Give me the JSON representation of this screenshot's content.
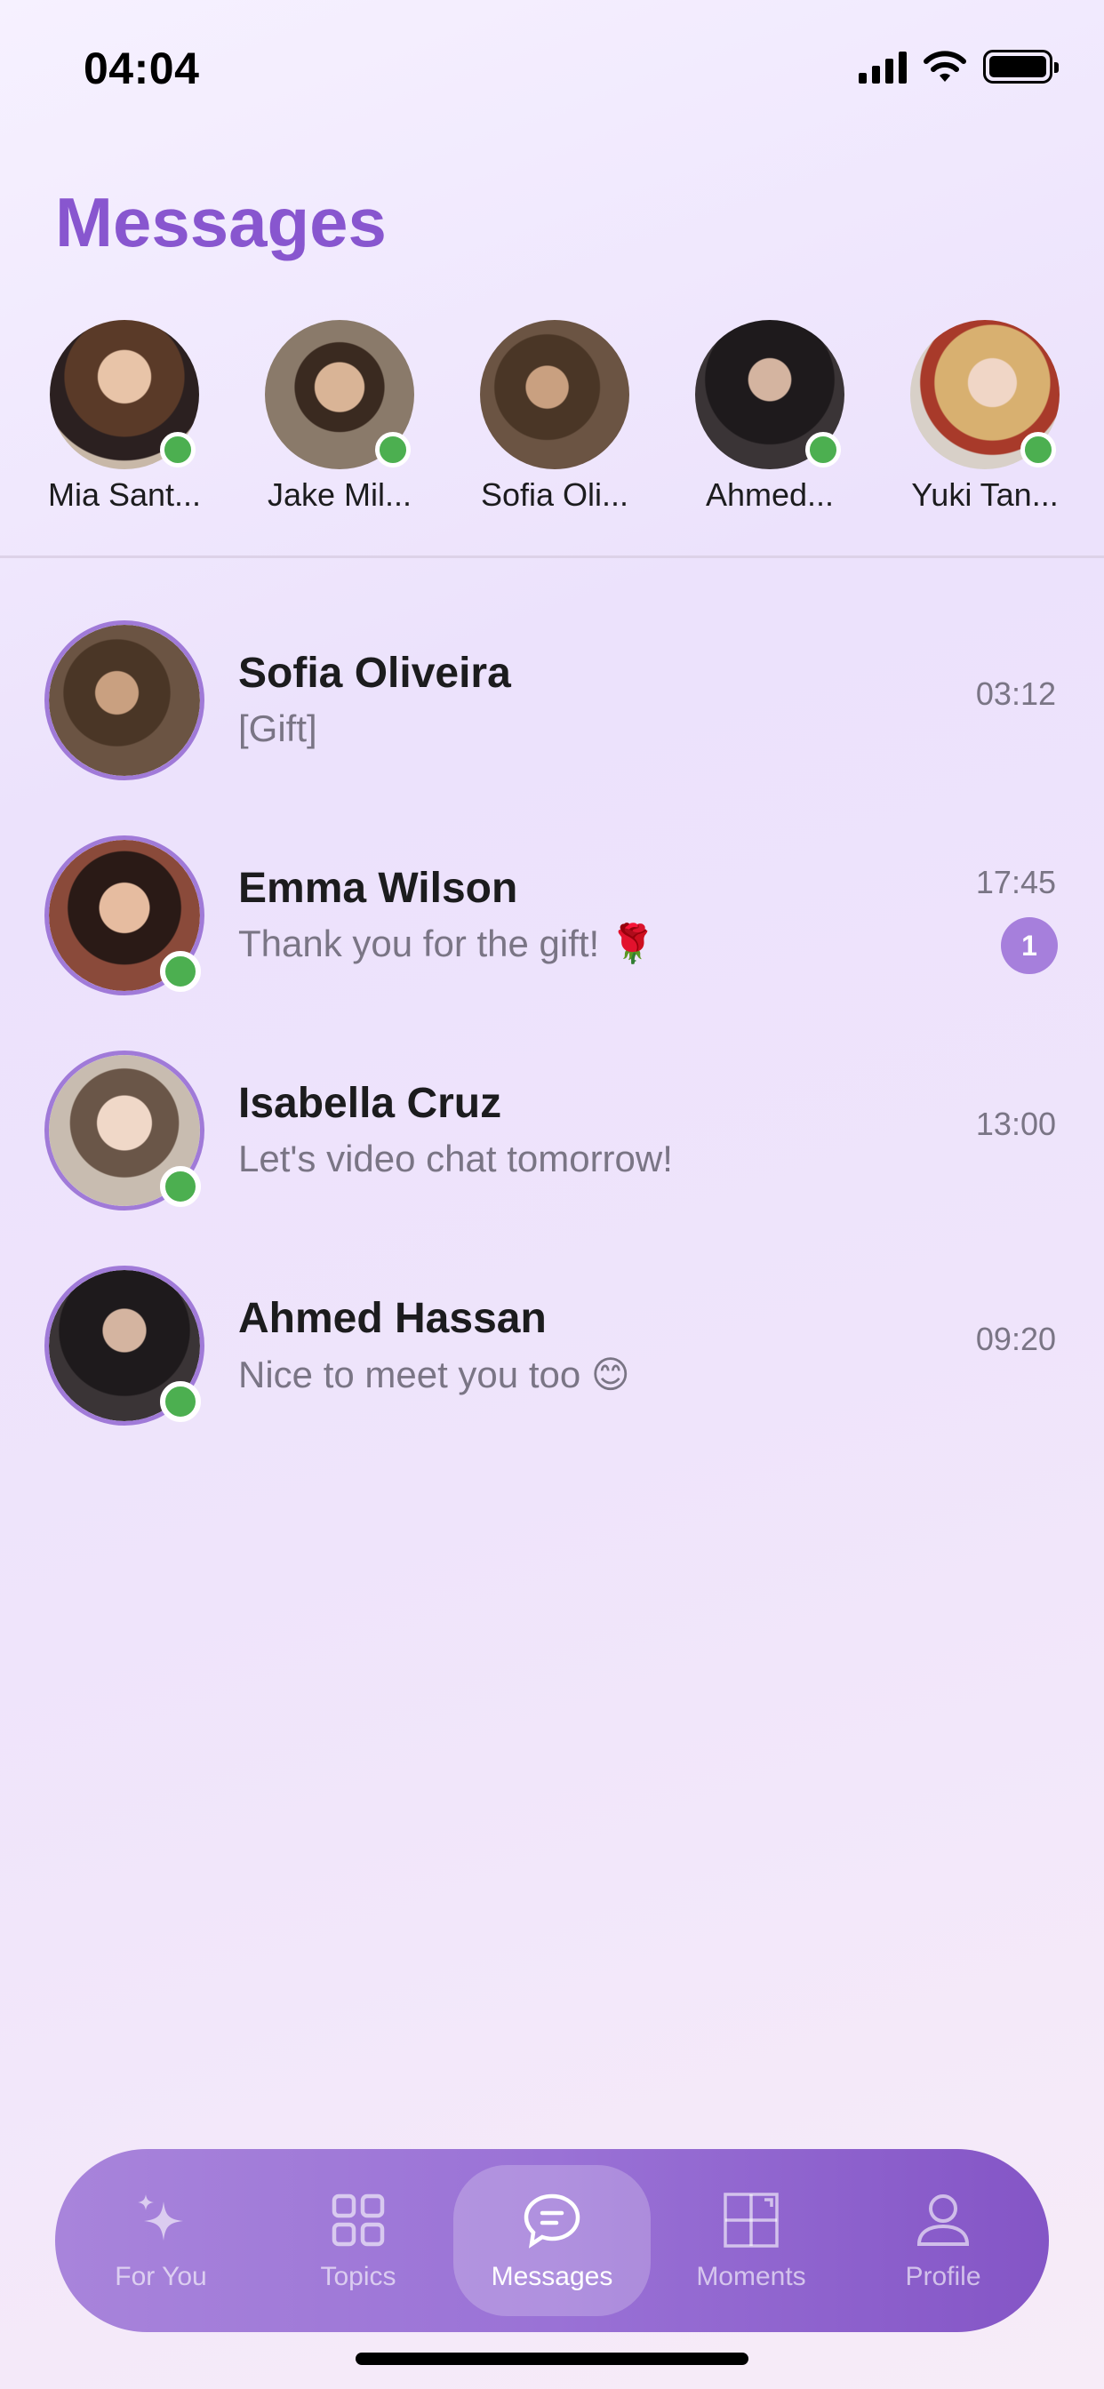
{
  "status_bar": {
    "time": "04:04"
  },
  "page_title": "Messages",
  "stories": [
    {
      "name": "Mia Sant...",
      "online": true
    },
    {
      "name": "Jake Mil...",
      "online": true
    },
    {
      "name": "Sofia Oli...",
      "online": false
    },
    {
      "name": "Ahmed...",
      "online": true
    },
    {
      "name": "Yuki Tan...",
      "online": true
    }
  ],
  "conversations": [
    {
      "name": "Sofia Oliveira",
      "preview": "[Gift]",
      "time": "03:12",
      "unread": null,
      "online": false
    },
    {
      "name": "Emma Wilson",
      "preview": "Thank you for the gift! 🌹",
      "time": "17:45",
      "unread": "1",
      "online": true
    },
    {
      "name": "Isabella Cruz",
      "preview": "Let's video chat tomorrow!",
      "time": "13:00",
      "unread": null,
      "online": true
    },
    {
      "name": "Ahmed Hassan",
      "preview": "Nice to meet you too 😊",
      "time": "09:20",
      "unread": null,
      "online": true
    }
  ],
  "tabbar": {
    "active": "Messages",
    "tabs": [
      {
        "label": "For You",
        "icon": "sparkle-icon"
      },
      {
        "label": "Topics",
        "icon": "grid-icon"
      },
      {
        "label": "Messages",
        "icon": "chat-bubble-icon"
      },
      {
        "label": "Moments",
        "icon": "moments-grid-icon"
      },
      {
        "label": "Profile",
        "icon": "person-icon"
      }
    ]
  },
  "colors": {
    "accent": "#8856cf",
    "online": "#4caf50",
    "badge": "#a67fdc",
    "tabbar_start": "#a884db",
    "tabbar_end": "#8455c6"
  }
}
